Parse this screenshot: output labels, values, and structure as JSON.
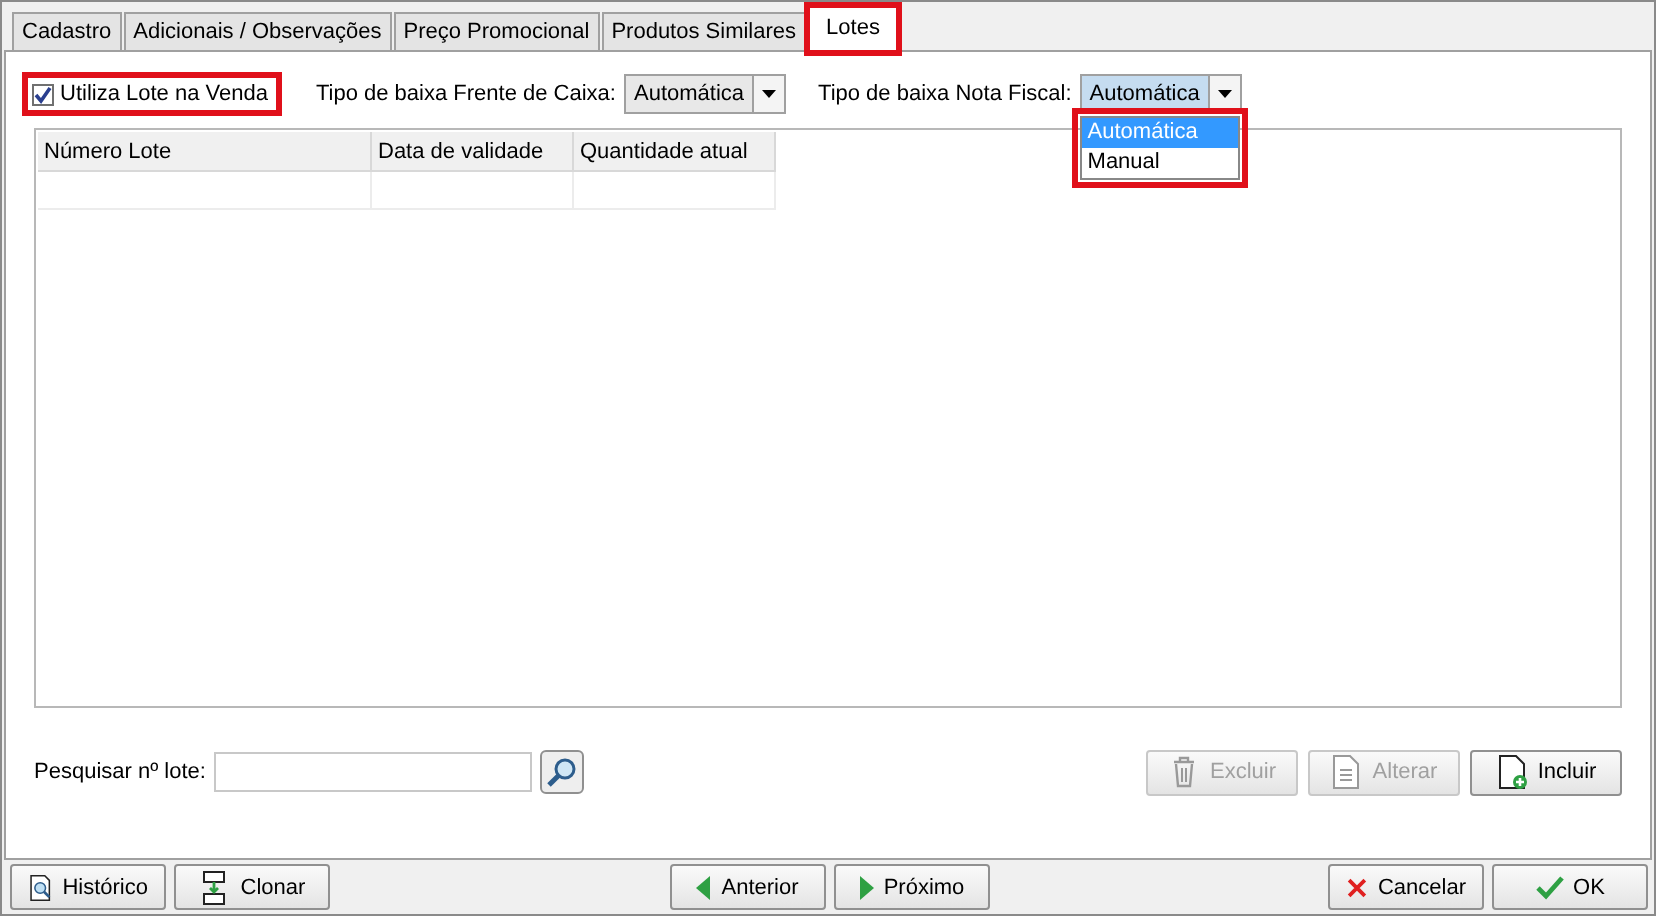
{
  "tabs": [
    {
      "label": "Cadastro",
      "selected": false,
      "highlighted": false
    },
    {
      "label": "Adicionais / Observações",
      "selected": false,
      "highlighted": false
    },
    {
      "label": "Preço Promocional",
      "selected": false,
      "highlighted": false
    },
    {
      "label": "Produtos Similares",
      "selected": false,
      "highlighted": false
    },
    {
      "label": "Lotes",
      "selected": true,
      "highlighted": true
    }
  ],
  "use_lot_checkbox": {
    "label": "Utiliza Lote na Venda",
    "checked": true,
    "highlighted": true
  },
  "pos_writeoff": {
    "label": "Tipo de baixa Frente de Caixa:",
    "value": "Automática"
  },
  "invoice_writeoff": {
    "label": "Tipo de baixa Nota Fiscal:",
    "value": "Automática",
    "expanded": true,
    "highlighted": true,
    "options": [
      {
        "label": "Automática",
        "selected": true
      },
      {
        "label": "Manual",
        "selected": false
      }
    ]
  },
  "table": {
    "columns": [
      "Número Lote",
      "Data de validade",
      "Quantidade atual"
    ]
  },
  "search": {
    "label": "Pesquisar nº lote:"
  },
  "actions": [
    {
      "label": "Excluir",
      "kind": "delete",
      "disabled": true
    },
    {
      "label": "Alterar",
      "kind": "edit",
      "disabled": true
    },
    {
      "label": "Incluir",
      "kind": "add",
      "disabled": false
    }
  ],
  "footer_left": [
    {
      "label": "Histórico",
      "kind": "history"
    },
    {
      "label": "Clonar",
      "kind": "clone"
    }
  ],
  "footer_center": [
    {
      "label": "Anterior",
      "kind": "prev"
    },
    {
      "label": "Próximo",
      "kind": "next"
    }
  ],
  "footer_right": [
    {
      "label": "Cancelar",
      "kind": "cancel"
    },
    {
      "label": "OK",
      "kind": "ok"
    }
  ]
}
